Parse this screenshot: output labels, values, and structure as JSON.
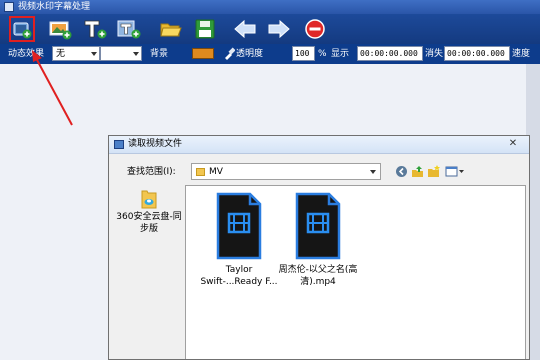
{
  "window": {
    "title": "视频水印字幕处理"
  },
  "toolbar": {
    "buttons": [
      {
        "name": "add-video-button",
        "icon": "film-add-icon"
      },
      {
        "name": "add-image-button",
        "icon": "image-add-icon"
      },
      {
        "name": "add-text-button",
        "icon": "text-add-icon"
      },
      {
        "name": "add-animated-text-button",
        "icon": "animated-text-add-icon"
      },
      {
        "name": "open-button",
        "icon": "folder-open-icon"
      },
      {
        "name": "save-button",
        "icon": "floppy-icon"
      },
      {
        "name": "back-button",
        "icon": "arrow-left-icon"
      },
      {
        "name": "forward-button",
        "icon": "arrow-right-icon"
      },
      {
        "name": "delete-button",
        "icon": "stop-minus-icon"
      }
    ]
  },
  "options": {
    "effect_label": "动态效果",
    "effect_value": "无",
    "background_label": "背景",
    "background_color": "#e08a1e",
    "transparency_label": "透明度",
    "transparency_value": "100",
    "percent_unit": "%",
    "show_label": "显示",
    "show_time": "00:00:00.000",
    "hide_label": "消失",
    "hide_time": "00:00:00.000",
    "speed_label": "速度"
  },
  "dialog": {
    "title": "读取视频文件",
    "look_in_label": "查找范围(I):",
    "look_in_value": "MV",
    "places": [
      {
        "label": "360安全云盘-同步版",
        "icon": "cloud-drive-icon"
      }
    ],
    "files": [
      {
        "name": "Taylor Swift-...Ready F...",
        "icon": "video-file-icon"
      },
      {
        "name": "周杰伦-以父之名(高清).mp4",
        "icon": "video-file-icon"
      }
    ]
  },
  "colors": {
    "accent": "#1d4a9a",
    "annotation": "#e02020"
  }
}
